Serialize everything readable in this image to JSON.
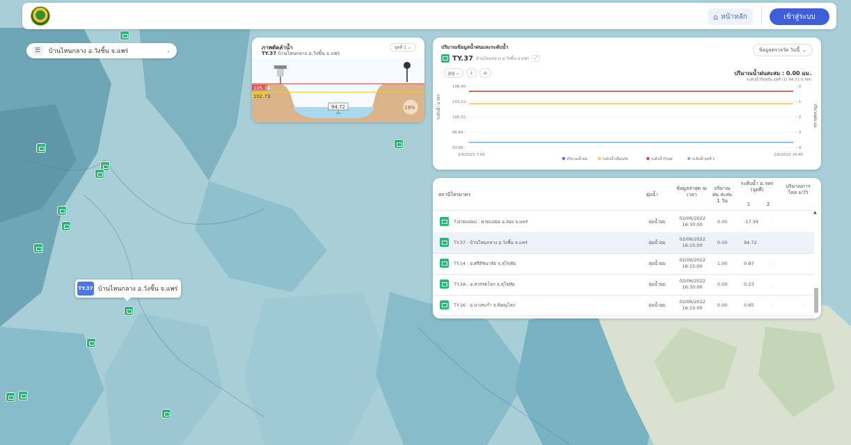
{
  "header": {
    "home_label": "หน้าหลัก",
    "login_label": "เข้าสู่ระบบ"
  },
  "station_select": {
    "value": "บ้านไหนกลาง อ.วังชิ้น จ.แพร่"
  },
  "cross_section": {
    "title": "ภาพตัดลำน้ำ",
    "station_code": "TY.37",
    "station_location": "บ้านไหนกลาง อ.วังชิ้น จ.แพร่",
    "point_select": "จุดที่ 1",
    "level_top": "105.34",
    "level_bank": "102.73",
    "level_water": "94.72",
    "percent": "19%"
  },
  "chart_panel": {
    "title": "ปริมาณข้อมูลน้ำฝนและระดับน้ำ",
    "station_code": "TY.37",
    "station_location": "บ้านไหนกลาง อ.วังชิ้น จ.แพร่",
    "format_select": "jpg",
    "data_select": "ข้อมูลตรวจวัด วันนี้",
    "total_rain": "ปริมาณน้ำฝนสะสม : 0.00 มม.",
    "current_level": "ระดับน้ำปัจจุบัน จุดที่ (1) 94.72 ม.รทก",
    "left_axis_label": "ระดับน้ำ ม.รทก",
    "right_axis_label": "ปริมาณฝน มม.",
    "x_start": "2/6/2022 7:00",
    "x_end": "2/6/2022 16:45",
    "y_ticks": [
      "106.40",
      "103.22",
      "100.02",
      "96.84",
      "93.66"
    ],
    "right_ticks": [
      "0",
      "1",
      "2",
      "3",
      "4"
    ],
    "legend": [
      "ปริมาณน้ำฝน",
      "ระดับน้ำเตือนภัย",
      "ระดับน้ำวิกฤต",
      "ระดับน้ำจุดที่ 1"
    ],
    "colors": {
      "rain": "#4a78e6",
      "warning": "#f5c542",
      "critical": "#d63a3a",
      "level": "#6fb4e8"
    }
  },
  "chart_data": {
    "type": "line",
    "x": [
      "2/6/2022 7:00",
      "2/6/2022 16:45"
    ],
    "series": [
      {
        "name": "ระดับน้ำวิกฤต",
        "values": [
          105.34,
          105.34
        ]
      },
      {
        "name": "ระดับน้ำเตือนภัย",
        "values": [
          102.73,
          102.73
        ]
      },
      {
        "name": "ระดับน้ำจุดที่ 1",
        "values": [
          94.72,
          94.72
        ]
      },
      {
        "name": "ปริมาณน้ำฝน",
        "values": [
          0,
          0
        ]
      }
    ],
    "ylim": [
      93.66,
      106.4
    ],
    "ylabel": "ระดับน้ำ ม.รทก",
    "y2label": "ปริมาณฝน มม.",
    "y2lim": [
      0,
      4
    ]
  },
  "table": {
    "headers": {
      "station": "สถานีโทรมาตร",
      "basin": "ลุ่มน้ำ",
      "time": "ข้อมูลล่าสุด ณ เวลา",
      "rain": "ปริมาณฝน สะสม 1 วัน",
      "level": "ระดับน้ำ ม.รทก (จุดที่)",
      "level_1": "1",
      "level_2": "2",
      "flow": "ปริมาณการไหล ม³/วิ"
    },
    "rows": [
      {
        "name": "T.ฝายแม่ยม : ฝายแม่ยม อ.สอง จ.แพร่",
        "basin": "ลุ่มน้ำยม",
        "date": "02/06/2022",
        "time": "16:30:00",
        "rain": "0.00",
        "level1": "-17.39",
        "level2": "-",
        "flow": ""
      },
      {
        "name": "TY.37 : บ้านไหนกลาง อ.วังชิ้น จ.แพร่",
        "basin": "ลุ่มน้ำยม",
        "date": "02/06/2022",
        "time": "16:15:00",
        "rain": "0.00",
        "level1": "94.72",
        "level2": "-",
        "flow": ""
      },
      {
        "name": "TY.14 : อ.ศรีสัชนาลัย จ.สุโขทัย",
        "basin": "ลุ่มน้ำยม",
        "date": "02/06/2022",
        "time": "16:15:00",
        "rain": "1.00",
        "level1": "0.97",
        "level2": "-",
        "flow": ""
      },
      {
        "name": "TY.3A : อ.สวรรคโลก จ.สุโขทัย",
        "basin": "ลุ่มน้ำยม",
        "date": "02/06/2022",
        "time": "16:30:00",
        "rain": "0.00",
        "level1": "0.23",
        "level2": "-",
        "flow": ""
      },
      {
        "name": "TY.16 : อ.บางระกำ จ.พิษณุโลก",
        "basin": "ลุ่มน้ำยม",
        "date": "02/06/2022",
        "time": "16:15:00",
        "rain": "0.00",
        "level1": "0.65",
        "level2": "-",
        "flow": "-"
      }
    ]
  },
  "popup": {
    "tag": "TY.37",
    "label": "บ้านไหนกลาง อ.วังชิ้น จ.แพร่"
  }
}
